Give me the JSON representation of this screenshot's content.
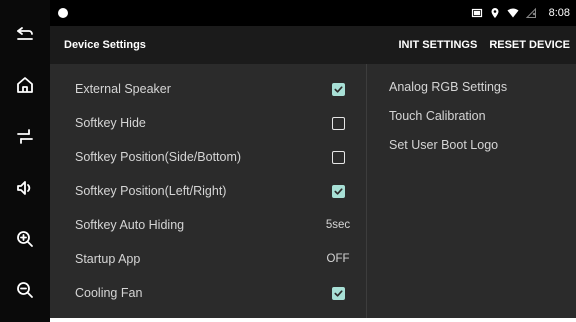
{
  "softkeys": [
    {
      "name": "back-icon"
    },
    {
      "name": "home-icon"
    },
    {
      "name": "softkey-position-icon"
    },
    {
      "name": "volume-icon"
    },
    {
      "name": "zoom-in-icon"
    },
    {
      "name": "zoom-out-icon"
    }
  ],
  "status_bar": {
    "time": "8:08",
    "icons": [
      "notification-dot-icon",
      "screenshot-icon",
      "location-icon",
      "wifi-icon",
      "no-signal-icon"
    ]
  },
  "header": {
    "title": "Device Settings",
    "init_label": "INIT SETTINGS",
    "reset_label": "RESET DEVICE"
  },
  "settings": [
    {
      "label": "External Speaker",
      "type": "checkbox",
      "checked": true
    },
    {
      "label": "Softkey Hide",
      "type": "checkbox",
      "checked": false
    },
    {
      "label": "Softkey Position(Side/Bottom)",
      "type": "checkbox",
      "checked": false
    },
    {
      "label": "Softkey Position(Left/Right)",
      "type": "checkbox",
      "checked": true
    },
    {
      "label": "Softkey Auto Hiding",
      "type": "value",
      "value": "5sec"
    },
    {
      "label": "Startup App",
      "type": "value",
      "value": "OFF"
    },
    {
      "label": "Cooling Fan",
      "type": "checkbox",
      "checked": true
    }
  ],
  "right_menu": [
    {
      "label": "Analog RGB Settings"
    },
    {
      "label": "Touch Calibration"
    },
    {
      "label": "Set User Boot Logo"
    }
  ],
  "colors": {
    "checkbox_checked": "#a8e0d6",
    "content_bg": "#2b2b2b",
    "header_bg": "#1b1b1b",
    "text": "#d5d5d5"
  }
}
